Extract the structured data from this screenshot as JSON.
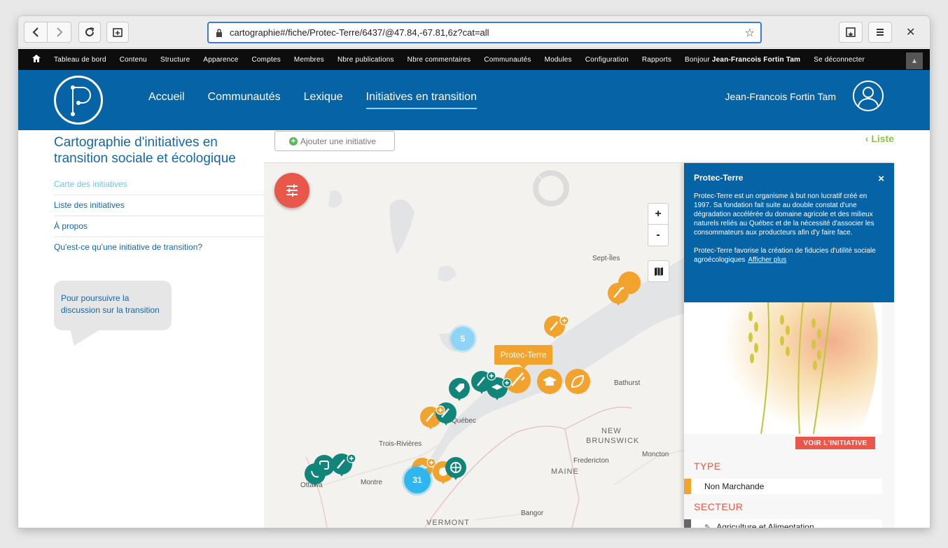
{
  "browser": {
    "url": "cartographie#/fiche/Protec-Terre/6437/@47.84,-67.81,6z?cat=all"
  },
  "adminbar": {
    "items": [
      "Tableau de bord",
      "Contenu",
      "Structure",
      "Apparence",
      "Comptes",
      "Membres",
      "Nbre publications",
      "Nbre commentaires",
      "Communautés",
      "Modules",
      "Configuration",
      "Rapports"
    ],
    "greeting": "Bonjour",
    "username": "Jean-Francois Fortin Tam",
    "logout": "Se déconnecter"
  },
  "nav": {
    "items": [
      "Accueil",
      "Communautés",
      "Lexique",
      "Initiatives en transition"
    ],
    "active_index": 3,
    "user": "Jean-Francois Fortin Tam"
  },
  "sidebar": {
    "title": "Cartographie d'initiatives en transition sociale et écologique",
    "links": [
      "Carte des initiatives",
      "Liste des initiatives",
      "À propos",
      "Qu'est-ce qu'une initiative de transition?"
    ],
    "bubble": "Pour poursuivre la discussion sur la transition"
  },
  "toolbar": {
    "add_label": "Ajouter une initiative",
    "list_label": "Liste"
  },
  "map": {
    "tooltip": "Protec-Terre",
    "zoom_in": "+",
    "zoom_out": "-",
    "labels": {
      "sept_iles": "Sept-Îles",
      "bathurst": "Bathurst",
      "new": "NEW",
      "brunswick": "BRUNSWICK",
      "fredericton": "Fredericton",
      "moncton": "Moncton",
      "maine": "MAINE",
      "trois_rivieres": "Trois-Rivières",
      "quebec": "Québec",
      "montreal": "Montre",
      "ottawa": "Ottawa",
      "vermont": "VERMONT",
      "bangor": "Bangor"
    },
    "clusters": {
      "a": "5",
      "b": "31"
    },
    "colors": {
      "orange": "#f2a32e",
      "teal": "#12857a",
      "blue": "#2fb6ee"
    }
  },
  "panel": {
    "title": "Protec-Terre",
    "close": "×",
    "desc1": "Protec-Terre est un organisme à but non lucratif créé en 1997. Sa fondation fait suite au double constat d'une dégradation accélérée du domaine agricole et des milieux naturels reliés au Québec et de la nécessité d'associer les consommateurs aux producteurs afin d'y faire face.",
    "desc2": "Protec-Terre favorise la création de fiducies d'utilité sociale agroécologiques",
    "more": "Afficher plus",
    "voir": "VOIR L'INITIATIVE",
    "type_heading": "TYPE",
    "type_value": "Non Marchande",
    "secteur_heading": "SECTEUR",
    "secteur_value": "Agriculture et Alimentation"
  }
}
